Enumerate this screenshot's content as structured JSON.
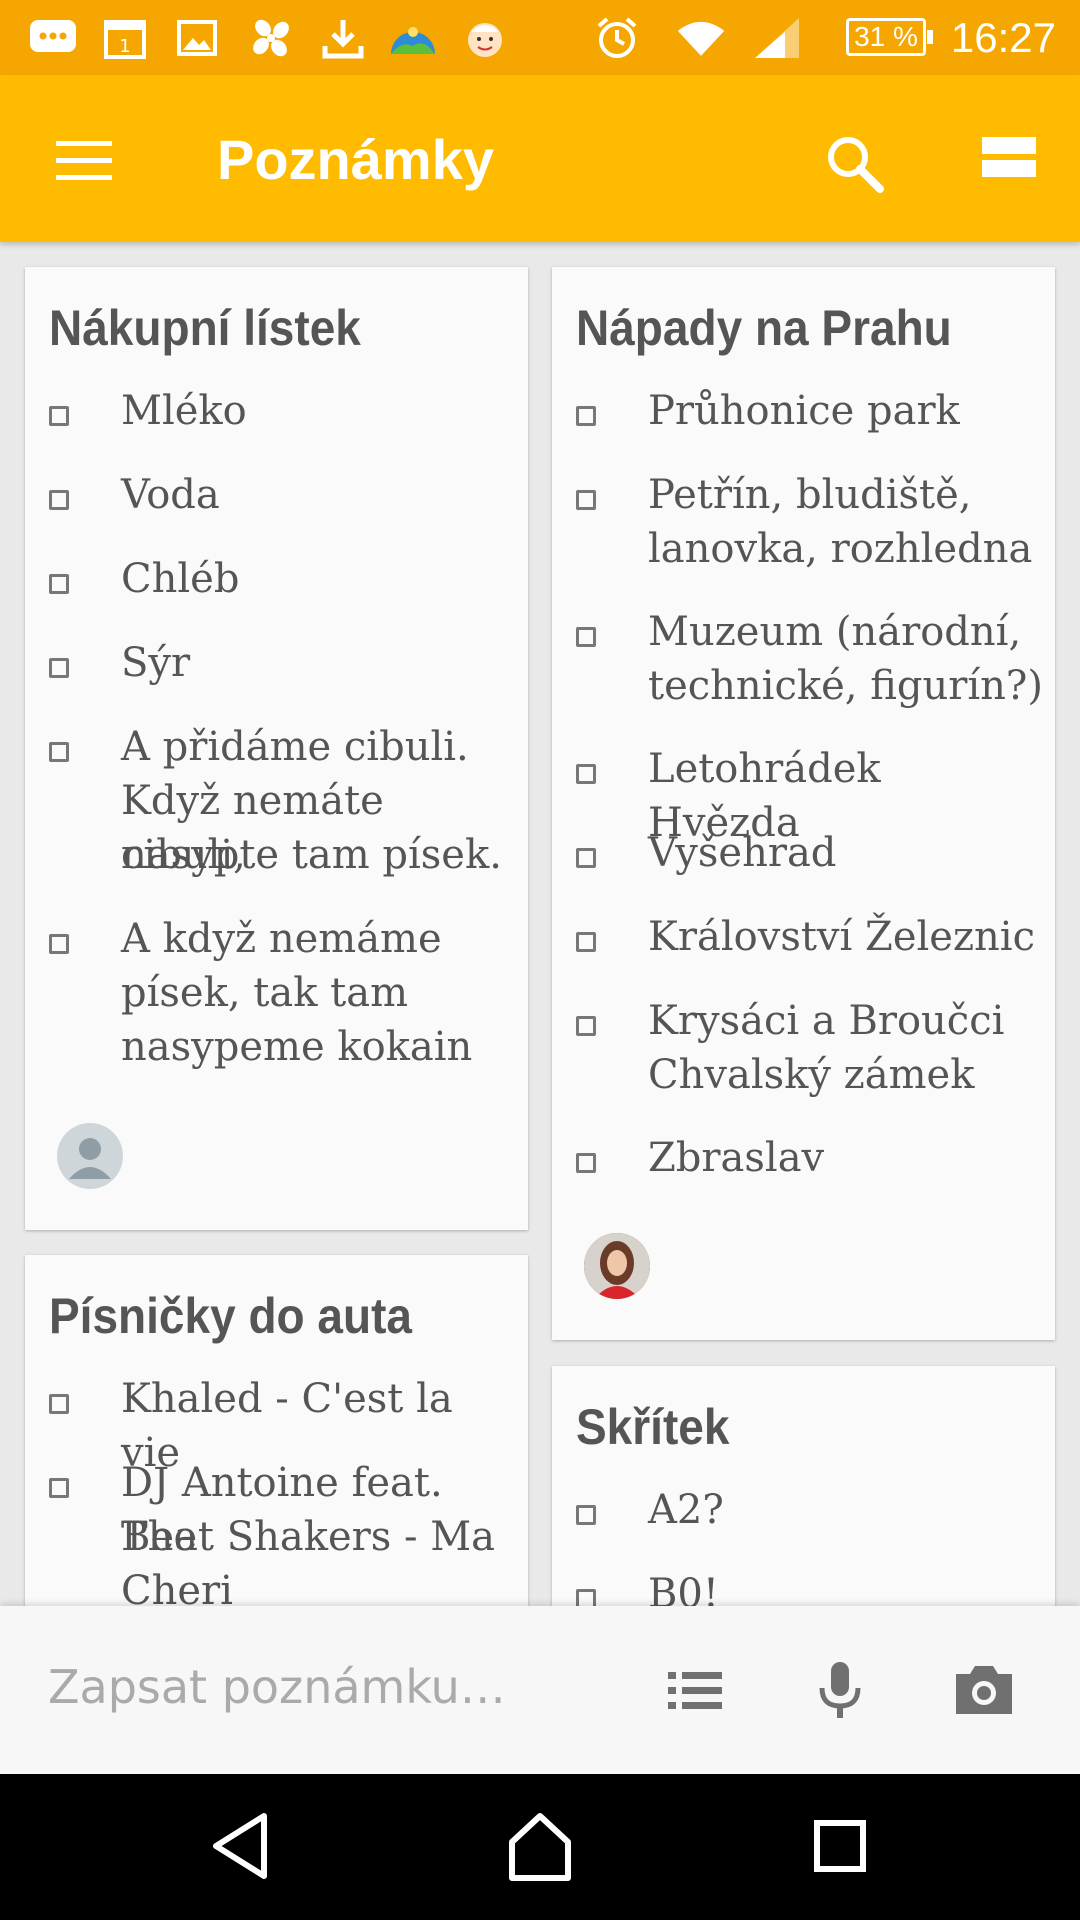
{
  "status_bar": {
    "time": "16:27",
    "battery": "31 %",
    "icons": [
      "messages-icon",
      "calendar-icon",
      "gallery-icon",
      "pinwheel-icon",
      "download-icon",
      "landscape-app-icon",
      "kid-app-icon",
      "alarm-icon",
      "wifi-icon",
      "signal-icon"
    ],
    "calendar_day": "1"
  },
  "app_bar": {
    "title": "Poznámky",
    "color": "#ffbb00"
  },
  "notes": [
    {
      "title": "Nákupní lístek",
      "items": [
        {
          "line1": "Mléko",
          "line2": "",
          "line3": ""
        },
        {
          "line1": "Voda",
          "line2": "",
          "line3": ""
        },
        {
          "line1": "Chléb",
          "line2": "",
          "line3": ""
        },
        {
          "line1": "Sýr",
          "line2": "",
          "line3": ""
        },
        {
          "line1": "A přidáme cibuli.",
          "line2": "Když nemáte cibuli,",
          "line3": "nasypte tam písek."
        },
        {
          "line1": "A když nemáme",
          "line2": "písek, tak tam",
          "line3": "nasypeme kokain"
        }
      ]
    },
    {
      "title": "Nápady na Prahu",
      "items": [
        {
          "line1": "Průhonice park",
          "line2": ""
        },
        {
          "line1": "Petřín, bludiště,",
          "line2": "lanovka, rozhledna"
        },
        {
          "line1": "Muzeum (národní,",
          "line2": "technické, figurín?)"
        },
        {
          "line1": "Letohrádek Hvězda",
          "line2": ""
        },
        {
          "line1": "Vyšehrad",
          "line2": ""
        },
        {
          "line1": "Království Železnic",
          "line2": ""
        },
        {
          "line1": "Krysáci a Broučci",
          "line2": "Chvalský zámek"
        },
        {
          "line1": "Zbraslav",
          "line2": ""
        }
      ]
    },
    {
      "title": "Písničky do auta",
      "items": [
        {
          "line1": "Khaled - C'est la vie",
          "line2": "",
          "line3": ""
        },
        {
          "line1": "DJ Antoine feat. The",
          "line2": "Beat Shakers - Ma",
          "line3": "Cheri"
        }
      ]
    },
    {
      "title": "Skřítek",
      "items": [
        {
          "line1": "A2?"
        },
        {
          "line1": "B0!"
        }
      ]
    }
  ],
  "input_bar": {
    "placeholder": "Zapsat poznámku…"
  }
}
